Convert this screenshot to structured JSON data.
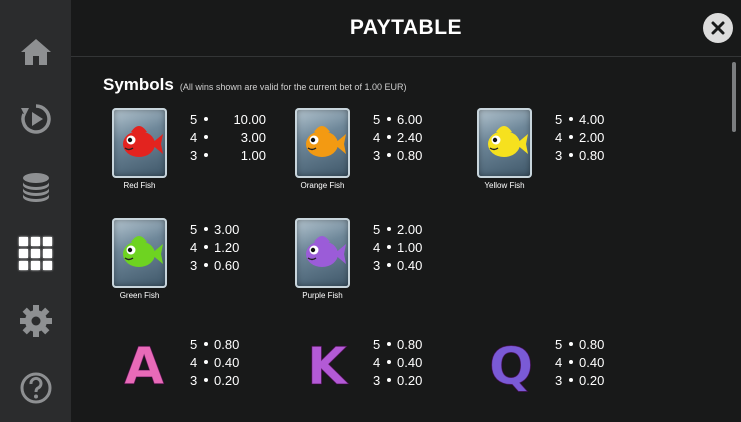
{
  "header": {
    "title": "PAYTABLE"
  },
  "sidebar": {
    "items": [
      {
        "icon": "home-icon"
      },
      {
        "icon": "replay-icon"
      },
      {
        "icon": "coin-stack-icon"
      },
      {
        "icon": "grid-icon",
        "active": true
      },
      {
        "icon": "gear-icon"
      },
      {
        "icon": "help-icon"
      }
    ]
  },
  "section": {
    "title": "Symbols",
    "note": "(All wins shown are valid for the current bet of 1.00 EUR)"
  },
  "symbols": [
    {
      "name": "Red Fish",
      "color": "#e3231f",
      "pays": [
        {
          "count": "5",
          "value": "10.00"
        },
        {
          "count": "4",
          "value": "3.00"
        },
        {
          "count": "3",
          "value": "1.00"
        }
      ]
    },
    {
      "name": "Orange Fish",
      "color": "#f39a12",
      "pays": [
        {
          "count": "5",
          "value": "6.00"
        },
        {
          "count": "4",
          "value": "2.40"
        },
        {
          "count": "3",
          "value": "0.80"
        }
      ]
    },
    {
      "name": "Yellow Fish",
      "color": "#f6e11e",
      "pays": [
        {
          "count": "5",
          "value": "4.00"
        },
        {
          "count": "4",
          "value": "2.00"
        },
        {
          "count": "3",
          "value": "0.80"
        }
      ]
    },
    {
      "name": "Green Fish",
      "color": "#6ed321",
      "pays": [
        {
          "count": "5",
          "value": "3.00"
        },
        {
          "count": "4",
          "value": "1.20"
        },
        {
          "count": "3",
          "value": "0.60"
        }
      ]
    },
    {
      "name": "Purple Fish",
      "color": "#9b5cd8",
      "pays": [
        {
          "count": "5",
          "value": "2.00"
        },
        {
          "count": "4",
          "value": "1.00"
        },
        {
          "count": "3",
          "value": "0.40"
        }
      ]
    },
    {
      "letter": "A",
      "color": "#e86ab8",
      "pays": [
        {
          "count": "5",
          "value": "0.80"
        },
        {
          "count": "4",
          "value": "0.40"
        },
        {
          "count": "3",
          "value": "0.20"
        }
      ]
    },
    {
      "letter": "K",
      "color": "#b35ad6",
      "pays": [
        {
          "count": "5",
          "value": "0.80"
        },
        {
          "count": "4",
          "value": "0.40"
        },
        {
          "count": "3",
          "value": "0.20"
        }
      ]
    },
    {
      "letter": "Q",
      "color": "#7a5ad6",
      "pays": [
        {
          "count": "5",
          "value": "0.80"
        },
        {
          "count": "4",
          "value": "0.40"
        },
        {
          "count": "3",
          "value": "0.20"
        }
      ]
    }
  ],
  "colors": {
    "sidebar": "#2b2c2d",
    "panel": "#181919",
    "close": "#dcdcdc"
  }
}
